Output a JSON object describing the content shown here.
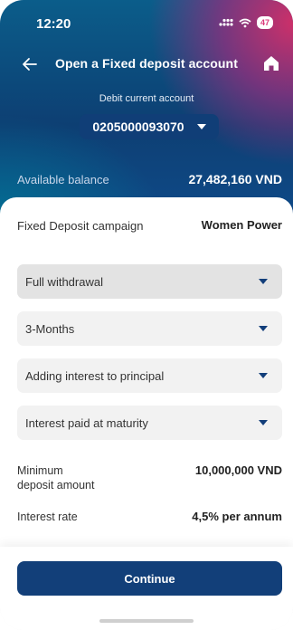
{
  "status_bar": {
    "time": "12:20",
    "battery": "47"
  },
  "header": {
    "title": "Open a Fixed deposit account"
  },
  "account": {
    "label": "Debit current account",
    "number": "0205000093070"
  },
  "balance": {
    "label": "Available balance",
    "value": "27,482,160 VND"
  },
  "campaign": {
    "label": "Fixed Deposit campaign",
    "value": "Women Power"
  },
  "selects": [
    {
      "label": "Full withdrawal"
    },
    {
      "label": "3-Months"
    },
    {
      "label": "Adding interest to principal"
    },
    {
      "label": "Interest paid at maturity"
    }
  ],
  "minimum": {
    "label_line1": "Minimum",
    "label_line2": "deposit amount",
    "value": "10,000,000 VND"
  },
  "interest": {
    "label": "Interest rate",
    "value": "4,5% per annum"
  },
  "footer": {
    "continue_label": "Continue"
  },
  "icons": [
    "back-arrow-icon",
    "home-icon",
    "signal-icon",
    "wifi-icon",
    "battery-icon",
    "chevron-down-icon"
  ],
  "colors": {
    "primary": "#123f79",
    "accent_pink": "#d62e68",
    "field_bg": "#f2f2f2"
  }
}
